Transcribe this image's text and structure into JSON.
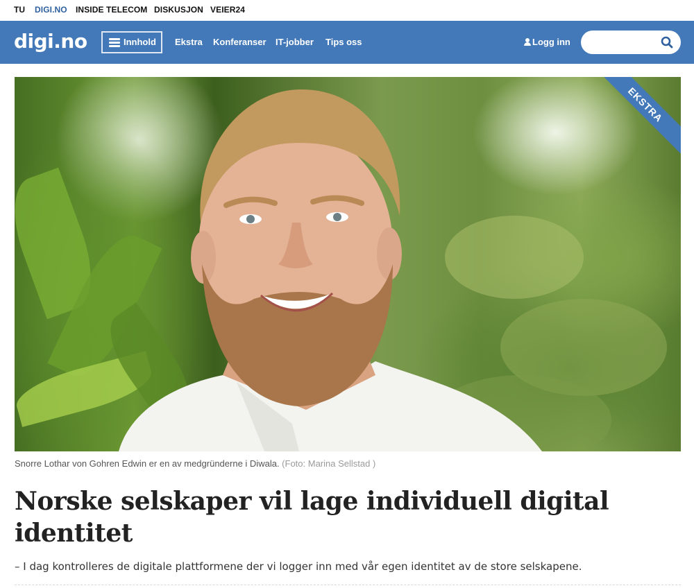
{
  "topbar": {
    "links": [
      "TU",
      "DIGI.NO",
      "INSIDE TELECOM",
      "DISKUSJON",
      "VEIER24"
    ],
    "active_link": "DIGI.NO"
  },
  "nav": {
    "logo": "digi.no",
    "menu_button": "Innhold",
    "menu_icon": "hamburger-icon",
    "links": [
      "Ekstra",
      "Konferanser",
      "IT-jobber",
      "Tips oss"
    ],
    "login": "Logg inn",
    "login_icon": "user-icon",
    "search": {
      "value": "",
      "placeholder": "",
      "icon": "search-icon"
    }
  },
  "hero": {
    "ribbon": "EKSTRA",
    "caption": "Snorre Lothar von Gohren Edwin er en av medgründerne i Diwala.",
    "credit": "(Foto: Marina Sellstad )"
  },
  "article": {
    "title": "Norske selskaper vil lage individuell digital identitet",
    "lead": "– I dag kontrolleres de digitale plattformene der vi logger inn med vår egen identitet av de store selskapene."
  },
  "colors": {
    "brand_blue": "#4379b8",
    "active_link": "#2e5f9e"
  }
}
